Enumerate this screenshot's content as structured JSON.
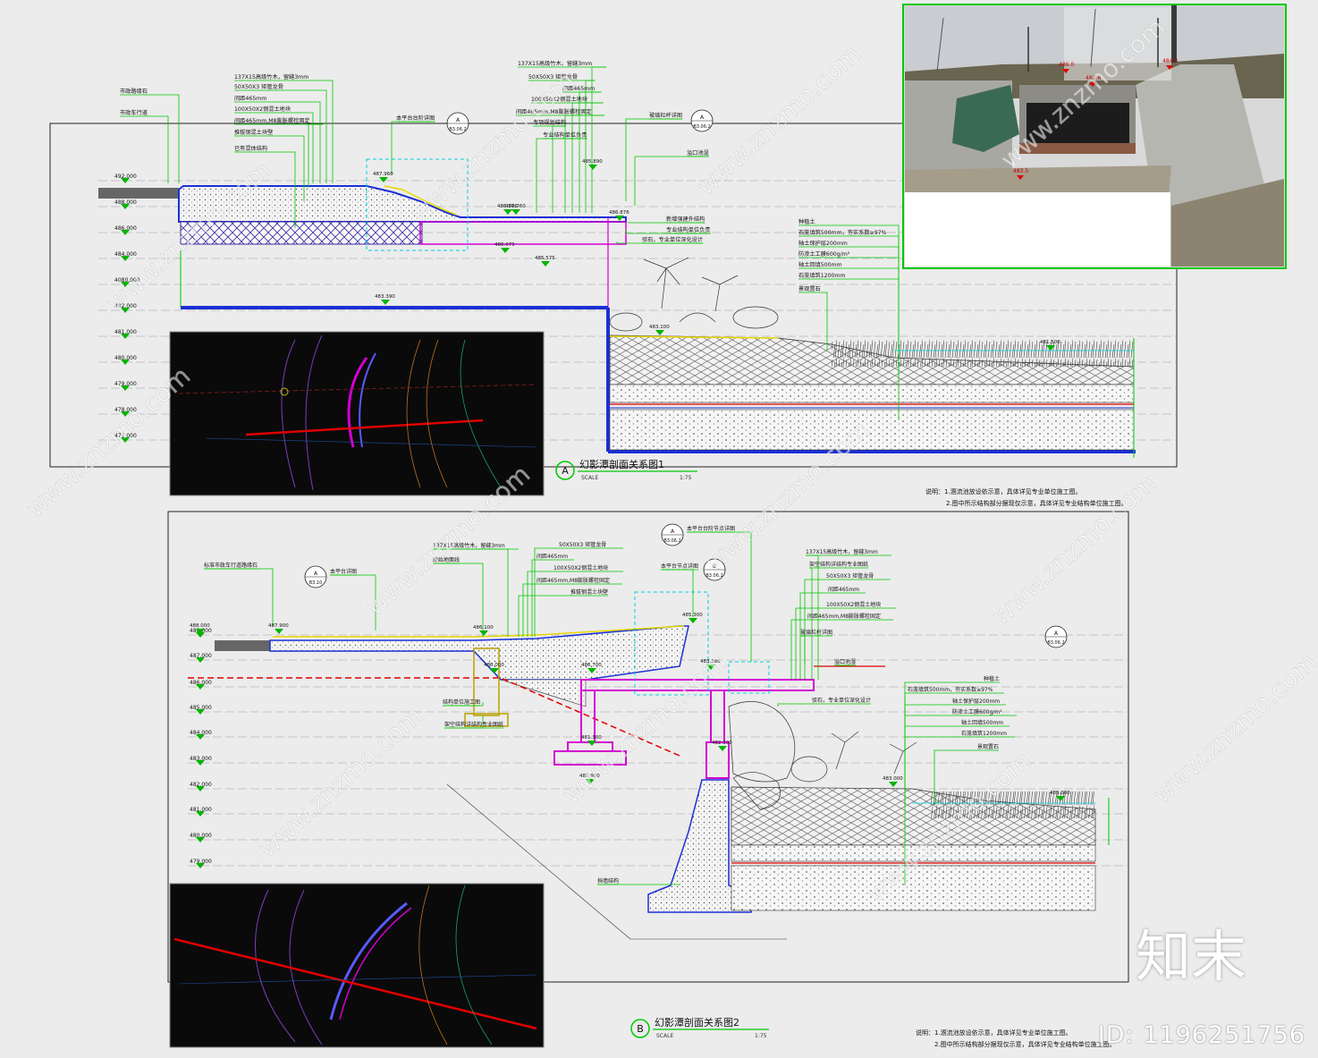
{
  "section_a": {
    "title": "幻影潭剖面关系图1",
    "marker": "A",
    "scale_word": "SCALE",
    "scale": "1:75",
    "notes": [
      "说明：1.溷流池放设依示意，具体详见专业单位施工图。",
      "2.图中所示结构部分据现仅示意，具体详见专业结构单位施工图。"
    ],
    "elev_labels": [
      "492.000",
      "488.000",
      "486.000",
      "484.000",
      "4080.000",
      "482.000",
      "481.000",
      "480.000",
      "479.000",
      "478.000",
      "477.000"
    ],
    "callouts": [
      "市政路缘石",
      "市政车行道",
      "137X15高级竹木，留缝3mm",
      "50X50X3 矩管龙骨",
      "间距465mm",
      "100X50X2钢混土地块",
      "间距465mm,M8膨胀螺栓固定",
      "推拔钢混土块壁",
      "已有混体结构",
      "本平台台阶详图",
      "137X15高级竹木，留缝3mm",
      "50X50X3 矩管龙骨",
      "间距465mm",
      "100X50X2钢混土地块",
      "间距465mm,M8膨胀螺栓固定",
      "专项规划结构",
      "专业结构单位负责",
      "玻璃栏杆详图",
      "溢口池湿",
      "新增强建外结构",
      "专业结构单位负责",
      "驳石，专业单位深化设计",
      "种植土",
      "石笼填筑500mm，夯实系数≥97%",
      "轴土保护层200mm",
      "防渗土工膜600g/m²",
      "轴土回填500mm",
      "石笼填筑1200mm",
      "景观置石"
    ],
    "elev_points": [
      "487.960",
      "486.876",
      "486.760",
      "486.075",
      "485.575",
      "486.876",
      "485.890",
      "483.100",
      "481.500",
      "483.390"
    ]
  },
  "section_b": {
    "title": "幻影潭剖面关系图2",
    "marker": "B",
    "scale_word": "SCALE",
    "scale": "1:75",
    "notes": [
      "说明：1.溷流池放设依示意，具体详见专业单位施工图。",
      "2.图中所示结构部分据现仅示意，具体详见专业结构单位施工图。"
    ],
    "elev_labels": [
      "488.000",
      "487.000",
      "486.000",
      "485.000",
      "484.000",
      "483.000",
      "482.000",
      "481.000",
      "480.000",
      "479.000"
    ],
    "callouts": [
      "标准市政车行道路缘石",
      "本平台详图",
      "137X15高级竹木，留缝3mm",
      "原始地面线",
      "50X50X3 矩管龙骨",
      "间距465mm",
      "100X50X2钢混土地块",
      "间距465mm,M8膨胀螺栓固定",
      "推拔钢混土块壁",
      "本平台节点详图",
      "本平台台阶节点详图",
      "137X15高级竹木，留缝3mm",
      "架空结构详结构专业图纸",
      "50X50X3 矩管龙骨",
      "间距465mm",
      "100X50X2钢混土地块",
      "间距465mm,M8膨胀螺栓固定",
      "玻璃栏杆详图",
      "溢口池湿",
      "驳石，专业单位深化设计",
      "种植土",
      "石笼填筑500mm，夯实系数≥97%",
      "轴土保护层200mm",
      "防渗土工膜600g/m²",
      "轴土回填500mm",
      "石笼填筑1200mm",
      "景观置石",
      "结构单位施工图",
      "架空结构详结构专业图纸",
      "挡墙结构"
    ],
    "elev_points": [
      "488.000",
      "487.900",
      "486.100",
      "486.000",
      "486.700",
      "485.300",
      "483.360",
      "482.100",
      "481.300",
      "480.900",
      "483.000",
      "485.000"
    ]
  },
  "refs": [
    {
      "top": "A",
      "bottom": "B3.06.2"
    },
    {
      "top": "A",
      "bottom": "B3.06.2"
    },
    {
      "top": "A",
      "bottom": "B3.10"
    },
    {
      "top": "A",
      "bottom": "B3.06.2"
    },
    {
      "top": "B",
      "bottom": "B3.06.2"
    },
    {
      "top": "A",
      "bottom": "B3.06.2"
    }
  ],
  "photo_labels": [
    "486.0",
    "482.8",
    "483.5",
    "484.3"
  ],
  "watermark": "www.znzmo.com",
  "brand": "知末",
  "id_text": "ID: 1196251756",
  "colors": {
    "background": "#ececec",
    "cad_green": "#00c800",
    "cad_blue": "#1a2fd6",
    "cad_magenta": "#d400d4",
    "cad_red": "#e00000",
    "cad_yellow": "#e8d800",
    "cad_cyan": "#00d0e0",
    "dark_panel": "#0a0a0a"
  }
}
